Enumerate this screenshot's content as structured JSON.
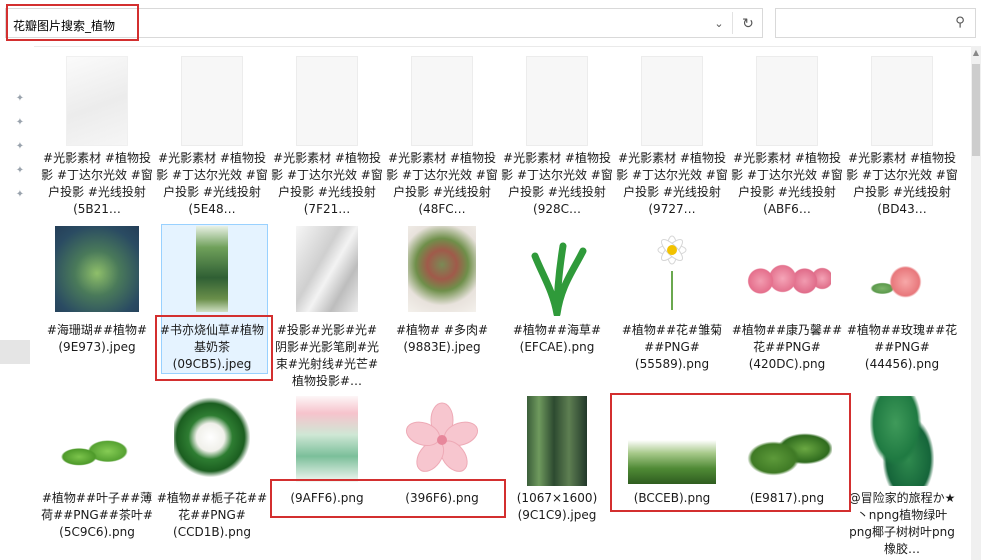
{
  "address_bar": {
    "path": "花瓣图片搜索_植物"
  },
  "search": {
    "placeholder": ""
  },
  "files": [
    {
      "name": "#光影素材 #植物投影 #丁达尔光效 #窗户投影 #光线投射(5B21…"
    },
    {
      "name": "#光影素材 #植物投影 #丁达尔光效 #窗户投影 #光线投射(5E48…"
    },
    {
      "name": "#光影素材 #植物投影 #丁达尔光效 #窗户投影 #光线投射(7F21…"
    },
    {
      "name": "#光影素材 #植物投影 #丁达尔光效 #窗户投影 #光线投射(48FC…"
    },
    {
      "name": "#光影素材 #植物投影 #丁达尔光效 #窗户投影 #光线投射(928C…"
    },
    {
      "name": "#光影素材 #植物投影 #丁达尔光效 #窗户投影 #光线投射(9727…"
    },
    {
      "name": "#光影素材 #植物投影 #丁达尔光效 #窗户投影 #光线投射(ABF6…"
    },
    {
      "name": "#光影素材 #植物投影 #丁达尔光效 #窗户投影 #光线投射(BD43…"
    },
    {
      "name": "#海珊瑚##植物#(9E973).jpeg"
    },
    {
      "name": "#书亦烧仙草#植物基奶茶(09CB5).jpeg"
    },
    {
      "name": "#投影#光影#光#阴影#光影笔刷#光束#光射线#光芒#植物投影#…"
    },
    {
      "name": "#植物# #多肉#(9883E).jpeg"
    },
    {
      "name": "#植物##海草#(EFCAE).png"
    },
    {
      "name": "#植物##花#雏菊##PNG#(55589).png"
    },
    {
      "name": "#植物##康乃馨##花##PNG#(420DC).png"
    },
    {
      "name": "#植物##玫瑰##花##PNG#(44456).png"
    },
    {
      "name": "#植物##叶子##薄荷##PNG##茶叶#(5C9C6).png"
    },
    {
      "name": "#植物##栀子花##花##PNG#(CCD1B).png"
    },
    {
      "name": "(9AFF6).png"
    },
    {
      "name": "(396F6).png"
    },
    {
      "name": "(1067×1600)(9C1C9).jpeg"
    },
    {
      "name": "(BCCEB).png"
    },
    {
      "name": "(E9817).png"
    },
    {
      "name": "@冒险家的旅程か★丶npng植物绿叶png椰子树树叶png 橡胶…"
    }
  ]
}
